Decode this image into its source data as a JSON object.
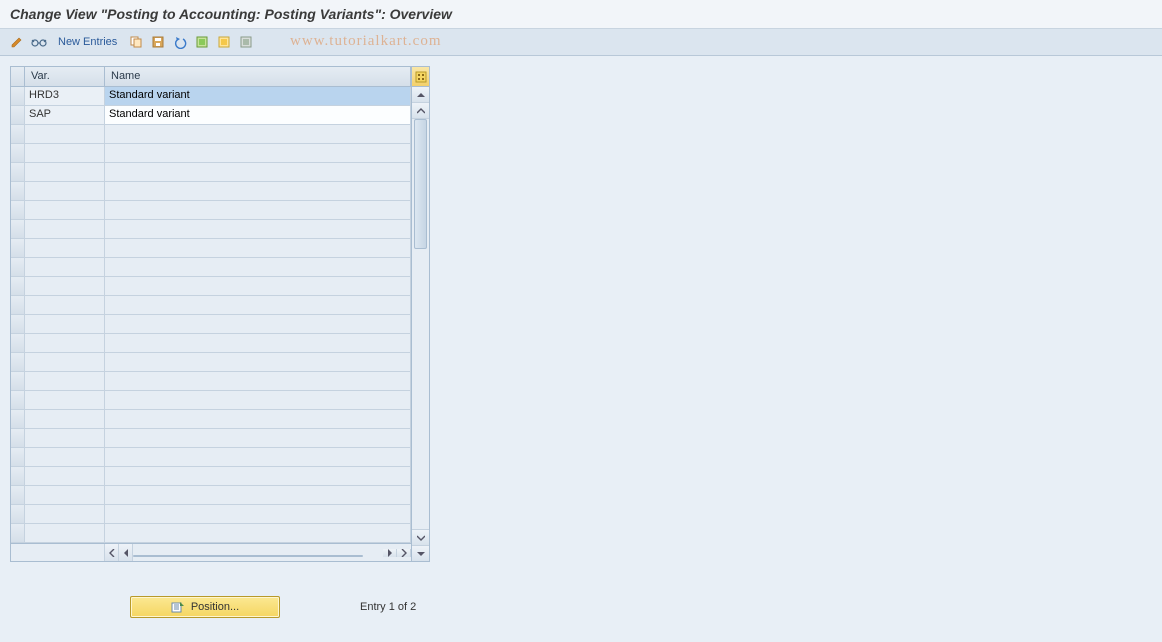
{
  "title": "Change View \"Posting to Accounting: Posting Variants\": Overview",
  "toolbar": {
    "new_entries": "New Entries"
  },
  "watermark": "www.tutorialkart.com",
  "columns": {
    "var": "Var.",
    "name": "Name"
  },
  "rows": [
    {
      "var": "HRD3",
      "name": "Standard variant",
      "selected": true
    },
    {
      "var": "SAP",
      "name": "Standard variant",
      "selected": false
    }
  ],
  "empty_row_count": 22,
  "footer": {
    "position": "Position...",
    "entry": "Entry 1 of 2"
  }
}
